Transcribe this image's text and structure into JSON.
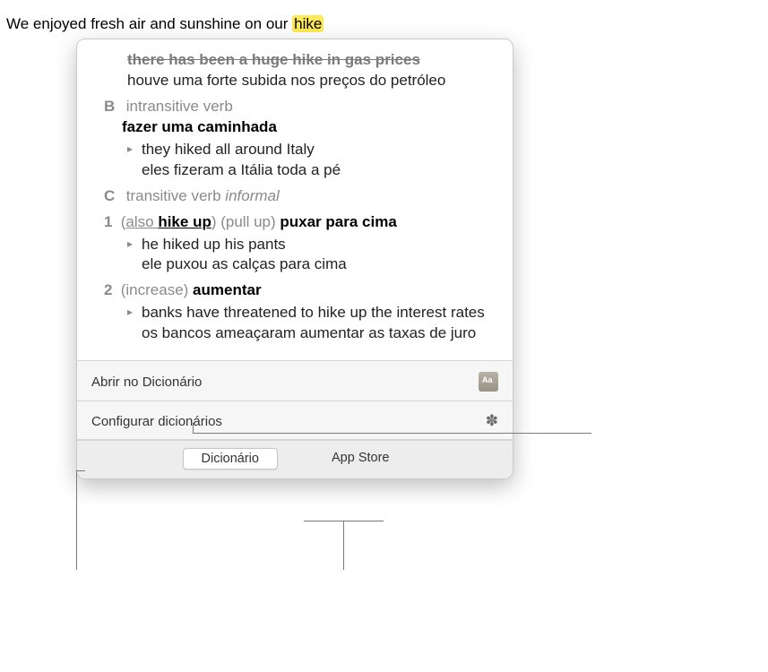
{
  "sentence": {
    "prefix": "We enjoyed fresh air and sunshine on our ",
    "highlight": "hike"
  },
  "definition": {
    "struck": "there has been a huge hike in gas prices",
    "line1": "houve uma forte subida nos preços do petróleo",
    "senseB": {
      "label": "B",
      "pos": "intransitive verb",
      "trans": "fazer uma caminhada",
      "ex_en": "they hiked all around Italy",
      "ex_pt": "eles fizeram a Itália toda a pé"
    },
    "senseC": {
      "label": "C",
      "pos": "transitive verb",
      "register": "informal",
      "sub1": {
        "num": "1",
        "also_open": "(",
        "also": "also ",
        "also_bold": "hike up",
        "paren": ") (pull up) ",
        "trans": "puxar para cima",
        "ex_en": "he hiked up his pants",
        "ex_pt": "ele puxou as calças para cima"
      },
      "sub2": {
        "num": "2",
        "paren": "(increase) ",
        "trans": "aumentar",
        "ex_en": "banks have threatened to hike up the interest rates",
        "ex_pt": "os bancos ameaçaram aumentar as taxas de juro"
      }
    }
  },
  "actions": {
    "open_dict": "Abrir no Dicionário",
    "configure": "Configurar dicionários"
  },
  "tabs": {
    "dict": "Dicionário",
    "appstore": "App Store"
  }
}
